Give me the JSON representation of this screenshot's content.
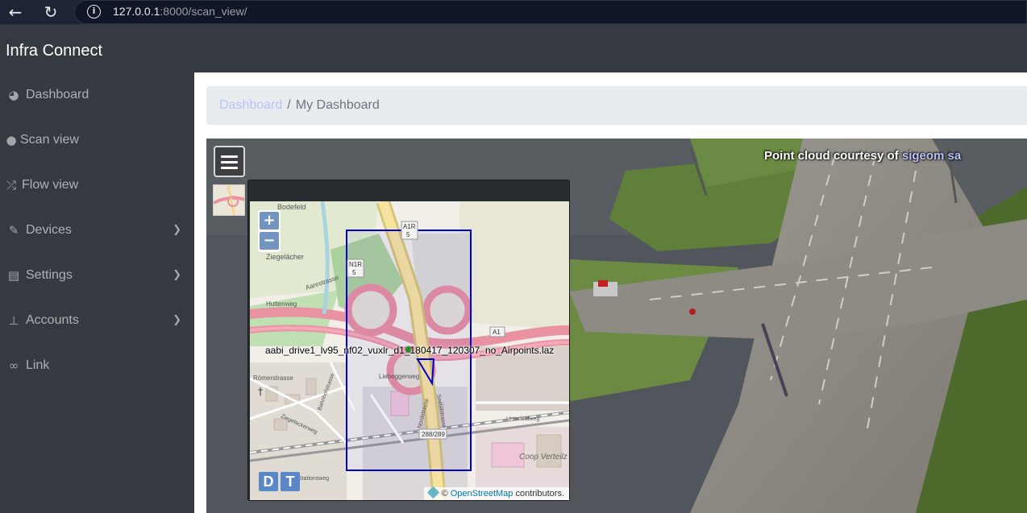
{
  "browser": {
    "url_host": "127.0.0.1",
    "url_rest": ":8000/scan_view/"
  },
  "app": {
    "brand": "Infra Connect"
  },
  "sidebar": {
    "items": [
      {
        "label": "Dashboard",
        "icon": "dashboard-icon",
        "has_submenu": false
      },
      {
        "label": "Scan view",
        "icon": "globe-icon",
        "has_submenu": false
      },
      {
        "label": "Flow view",
        "icon": "shuffle-icon",
        "has_submenu": false
      },
      {
        "label": "Devices",
        "icon": "wrench-icon",
        "has_submenu": true
      },
      {
        "label": "Settings",
        "icon": "file-icon",
        "has_submenu": true
      },
      {
        "label": "Accounts",
        "icon": "sitemap-icon",
        "has_submenu": true
      },
      {
        "label": "Link",
        "icon": "link-icon",
        "has_submenu": false
      }
    ]
  },
  "breadcrumb": {
    "link": "Dashboard",
    "separator": "/",
    "current": "My Dashboard"
  },
  "viewer": {
    "credit_prefix": "Point cloud courtesy of",
    "credit_link": "sigeom sa"
  },
  "map": {
    "zoom_in": "+",
    "zoom_out": "−",
    "pointcloud_label": "aabi_drive1_lv95_nf02_vuxlr_d1_180417_120307_no_Airpoints.laz",
    "button_d": "D",
    "button_t": "T",
    "attribution_symbol": "©",
    "attribution_link": "OpenStreetMap",
    "attribution_suffix": "contributors.",
    "labels": {
      "bodefeld": "Bodefeld",
      "ziegelacher": "Ziegelächer",
      "a1r": "A1R",
      "a1r_num": "5",
      "n1r": "N1R",
      "n1r_num": "5",
      "a1": "A1",
      "aarestrasse": "Aarestrasse",
      "huttenweg": "Huttenweg",
      "roemerstrasse": "Römerstrasse",
      "bahnhofstrasse": "Bahnhofstrasse",
      "ziegelackerweg": "Ziegelackerweg",
      "liebeggerweg": "Liebeggerweg",
      "nordstrasse": "Nordstrasse",
      "seetalstrasse": "Seetalstrasse",
      "unterfeldweg": "Unterfeldweg",
      "coop": "Coop Verteilz",
      "exit_num": "288/289",
      "stationsweg": "Stationsweg"
    }
  },
  "colors": {
    "accent_link": "#b8c4f8",
    "scan_box": "#0000cc",
    "motorway": "#e892a2"
  }
}
